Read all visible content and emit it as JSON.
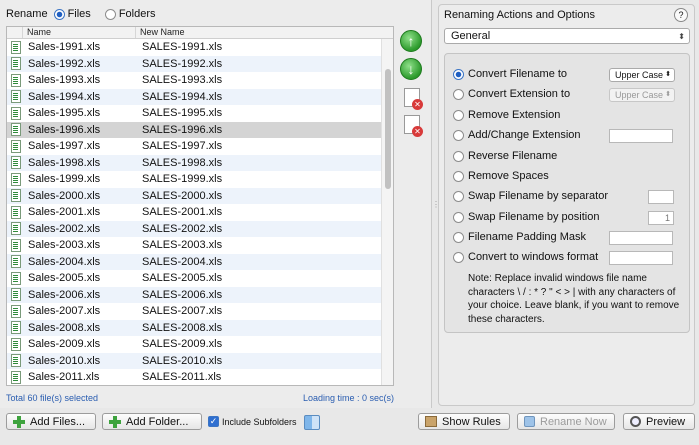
{
  "left": {
    "rename_label": "Rename",
    "files_label": "Files",
    "folders_label": "Folders",
    "columns": {
      "name": "Name",
      "new_name": "New Name"
    },
    "rows": [
      {
        "name": "Sales-1991.xls",
        "new": "SALES-1991.xls"
      },
      {
        "name": "Sales-1992.xls",
        "new": "SALES-1992.xls"
      },
      {
        "name": "Sales-1993.xls",
        "new": "SALES-1993.xls"
      },
      {
        "name": "Sales-1994.xls",
        "new": "SALES-1994.xls"
      },
      {
        "name": "Sales-1995.xls",
        "new": "SALES-1995.xls"
      },
      {
        "name": "Sales-1996.xls",
        "new": "SALES-1996.xls"
      },
      {
        "name": "Sales-1997.xls",
        "new": "SALES-1997.xls"
      },
      {
        "name": "Sales-1998.xls",
        "new": "SALES-1998.xls"
      },
      {
        "name": "Sales-1999.xls",
        "new": "SALES-1999.xls"
      },
      {
        "name": "Sales-2000.xls",
        "new": "SALES-2000.xls"
      },
      {
        "name": "Sales-2001.xls",
        "new": "SALES-2001.xls"
      },
      {
        "name": "Sales-2002.xls",
        "new": "SALES-2002.xls"
      },
      {
        "name": "Sales-2003.xls",
        "new": "SALES-2003.xls"
      },
      {
        "name": "Sales-2004.xls",
        "new": "SALES-2004.xls"
      },
      {
        "name": "Sales-2005.xls",
        "new": "SALES-2005.xls"
      },
      {
        "name": "Sales-2006.xls",
        "new": "SALES-2006.xls"
      },
      {
        "name": "Sales-2007.xls",
        "new": "SALES-2007.xls"
      },
      {
        "name": "Sales-2008.xls",
        "new": "SALES-2008.xls"
      },
      {
        "name": "Sales-2009.xls",
        "new": "SALES-2009.xls"
      },
      {
        "name": "Sales-2010.xls",
        "new": "SALES-2010.xls"
      },
      {
        "name": "Sales-2011.xls",
        "new": "SALES-2011.xls"
      }
    ],
    "status_total": "Total 60 file(s) selected",
    "status_loading": "Loading time : 0 sec(s)"
  },
  "right": {
    "title": "Renaming Actions and Options",
    "help": "?",
    "category": "General",
    "options": {
      "convert_filename": "Convert Filename to",
      "convert_extension": "Convert Extension to",
      "remove_extension": "Remove Extension",
      "add_change_extension": "Add/Change Extension",
      "reverse_filename": "Reverse Filename",
      "remove_spaces": "Remove Spaces",
      "swap_by_separator": "Swap Filename by separator",
      "swap_by_position": "Swap Filename by position",
      "padding_mask": "Filename Padding Mask",
      "convert_windows": "Convert to windows format"
    },
    "case_filename": "Upper Case",
    "case_extension": "Upper Case",
    "position_value": "1",
    "note": "Note: Replace invalid windows file name characters  \\ / : * ? \" < > | with any characters of your choice. Leave blank, if you want to remove these characters."
  },
  "bottom": {
    "add_files": "Add Files...",
    "add_folder": "Add Folder...",
    "include_subfolders": "Include Subfolders",
    "show_rules": "Show Rules",
    "rename_now": "Rename Now",
    "preview": "Preview"
  },
  "colors": {
    "accent": "#2f6fd0",
    "status_text": "#2a5db0",
    "selected_row": "#d4d4d4"
  }
}
